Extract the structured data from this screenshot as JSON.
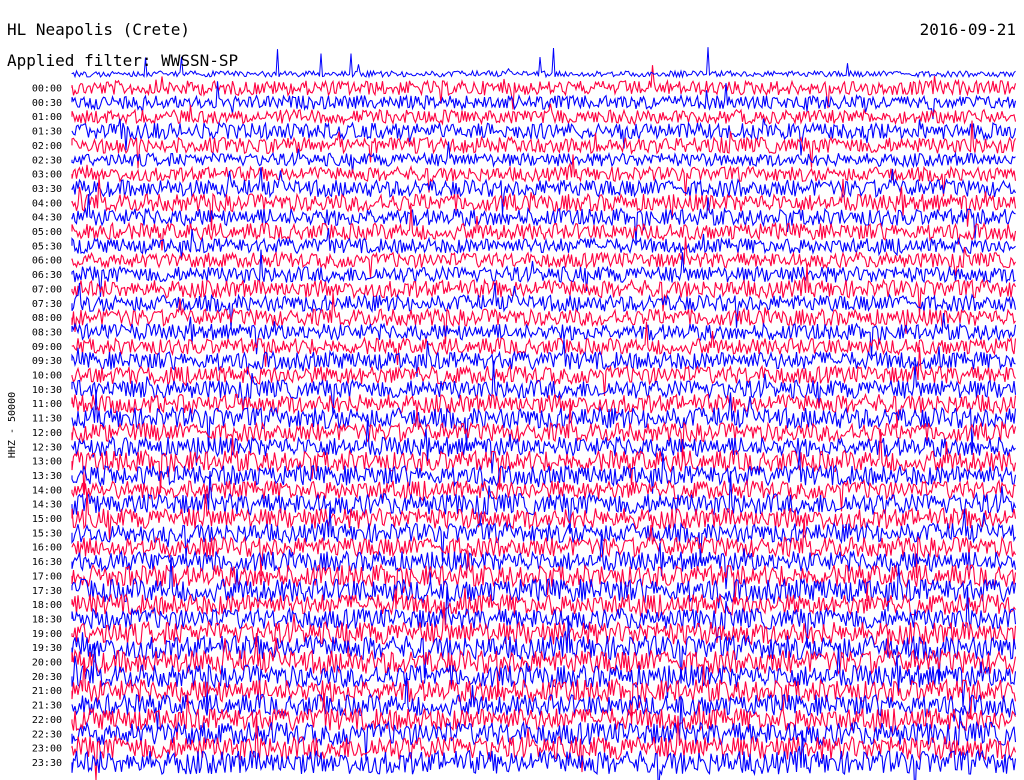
{
  "header": {
    "station": "HL Neapolis (Crete)",
    "date": "2016-09-21",
    "filter_label": "Applied filter: WWSSN-SP"
  },
  "chart_data": {
    "type": "line",
    "title": "HL Neapolis (Crete)",
    "subtitle": "Applied filter: WWSSN-SP",
    "date": "2016-09-21",
    "ylabel": "HHZ - 50000",
    "xlabel": "",
    "y_tick_labels": [
      "00:00",
      "00:30",
      "01:00",
      "01:30",
      "02:00",
      "02:30",
      "03:00",
      "03:30",
      "04:00",
      "04:30",
      "05:00",
      "05:30",
      "06:00",
      "06:30",
      "07:00",
      "07:30",
      "08:00",
      "08:30",
      "09:00",
      "09:30",
      "10:00",
      "10:30",
      "11:00",
      "11:30",
      "12:00",
      "12:30",
      "13:00",
      "13:30",
      "14:00",
      "14:30",
      "15:00",
      "15:30",
      "16:00",
      "16:30",
      "17:00",
      "17:30",
      "18:00",
      "18:30",
      "19:00",
      "19:30",
      "20:00",
      "20:30",
      "21:00",
      "21:30",
      "22:00",
      "22:30",
      "23:00",
      "23:30"
    ],
    "trace_colors": [
      "#ff0040",
      "#0000ff"
    ],
    "grid": false,
    "legend": "none"
  }
}
